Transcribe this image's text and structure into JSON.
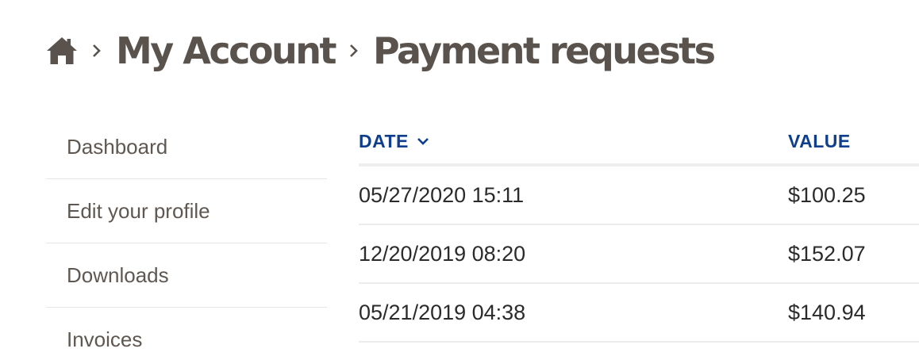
{
  "breadcrumb": {
    "home_icon": "home-icon",
    "separator_icon": "chevron-right-icon",
    "items": [
      {
        "label": "My Account"
      }
    ],
    "current": "Payment requests"
  },
  "sidebar": {
    "items": [
      {
        "label": "Dashboard"
      },
      {
        "label": "Edit your profile"
      },
      {
        "label": "Downloads"
      },
      {
        "label": "Invoices"
      }
    ]
  },
  "table": {
    "headers": {
      "date": "DATE",
      "value": "VALUE"
    },
    "sort_icon": "chevron-down-icon",
    "rows": [
      {
        "date": "05/27/2020 15:11",
        "value": "$100.25"
      },
      {
        "date": "12/20/2019 08:20",
        "value": "$152.07"
      },
      {
        "date": "05/21/2019 04:38",
        "value": "$140.94"
      }
    ]
  },
  "colors": {
    "heading_text": "#5a534d",
    "table_header": "#0f3f8c",
    "body_text": "#2b2b2b"
  }
}
